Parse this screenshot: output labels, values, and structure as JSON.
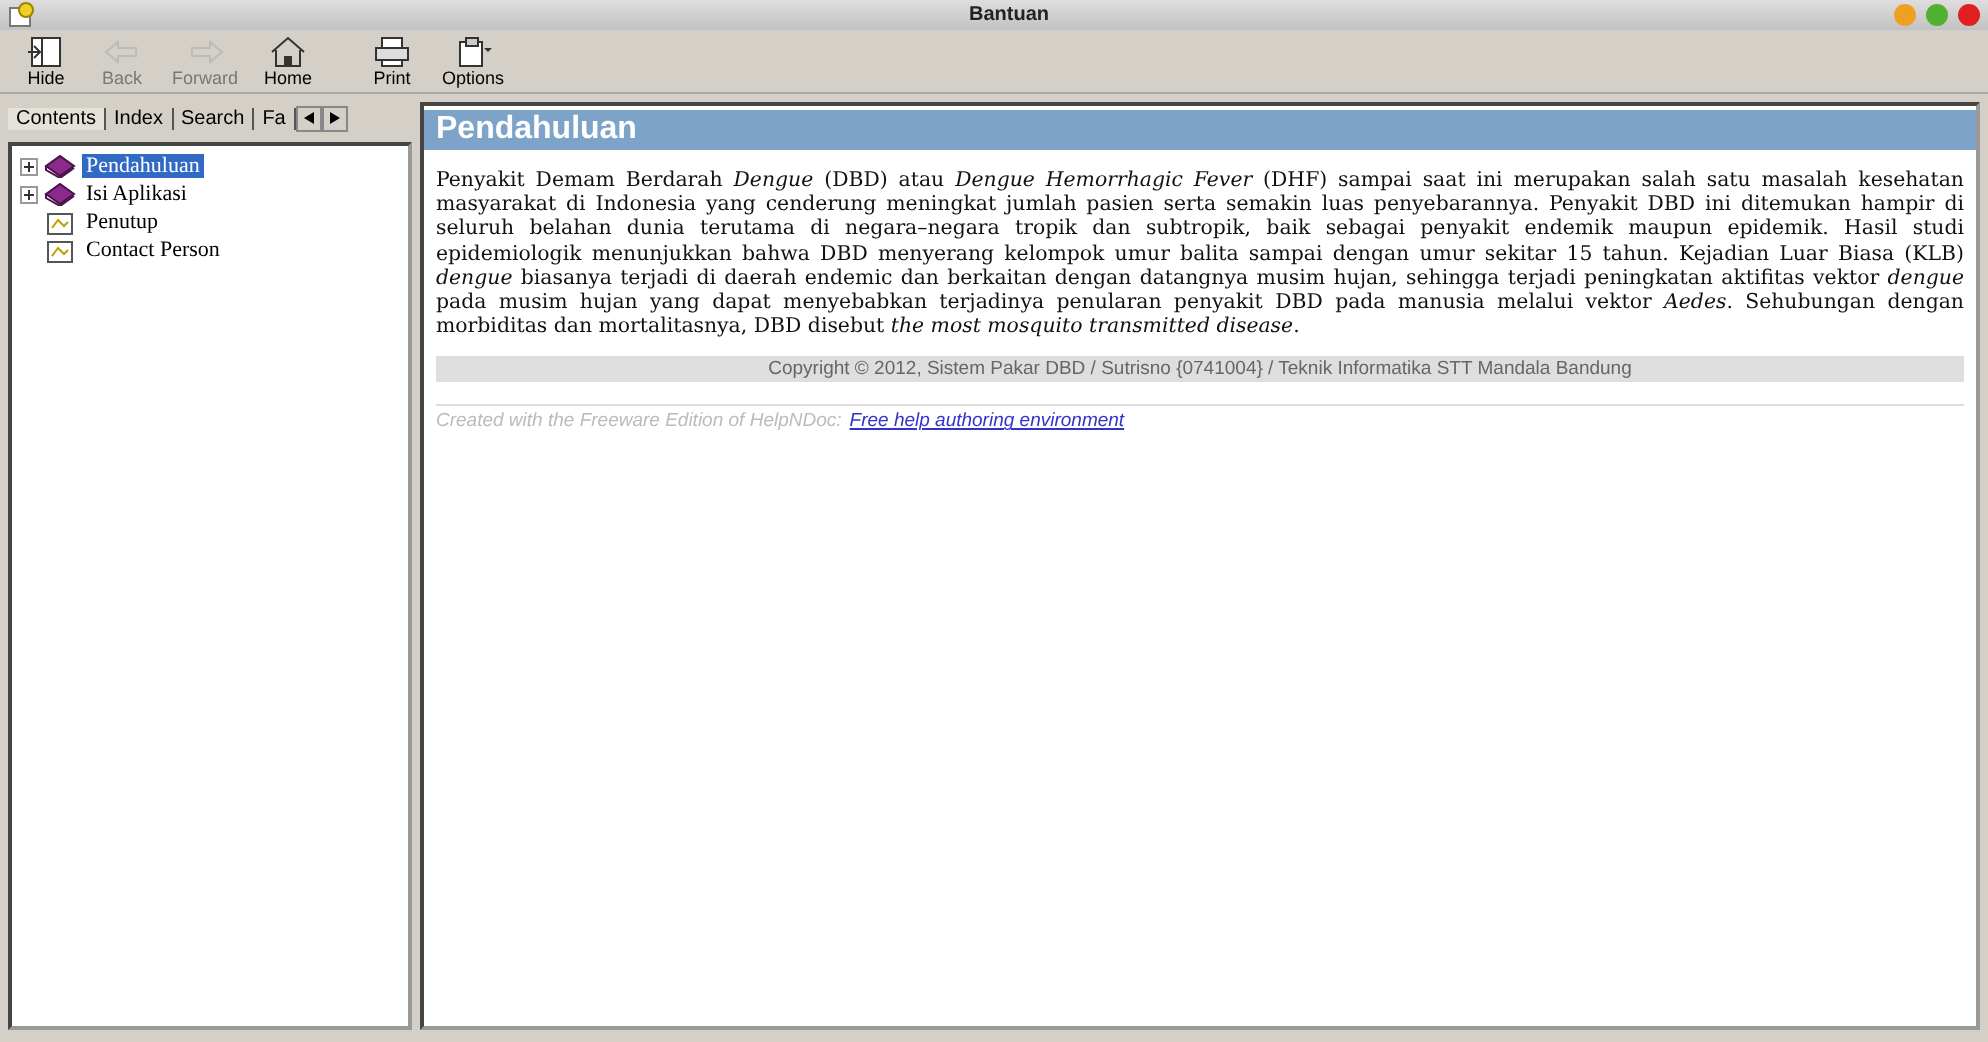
{
  "window": {
    "title": "Bantuan"
  },
  "toolbar": [
    {
      "label": "Hide",
      "kind": "hide",
      "disabled": false
    },
    {
      "label": "Back",
      "kind": "back",
      "disabled": true
    },
    {
      "label": "Forward",
      "kind": "forward",
      "disabled": true
    },
    {
      "label": "Home",
      "kind": "home",
      "disabled": false
    },
    {
      "label": "Print",
      "kind": "print",
      "disabled": false
    },
    {
      "label": "Options",
      "kind": "options",
      "disabled": false
    }
  ],
  "tabs": [
    {
      "label": "Contents",
      "selected": true
    },
    {
      "label": "Index",
      "selected": false
    },
    {
      "label": "Search",
      "selected": false
    },
    {
      "label": "Fa",
      "selected": false
    }
  ],
  "tree": [
    {
      "label": "Pendahuluan",
      "kind": "book",
      "expanded": false,
      "selected": true
    },
    {
      "label": "Isi Aplikasi",
      "kind": "book",
      "expanded": false,
      "selected": false
    },
    {
      "label": "Penutup",
      "kind": "page",
      "selected": false
    },
    {
      "label": "Contact Person",
      "kind": "page",
      "selected": false
    }
  ],
  "topic": {
    "title": "Pendahuluan",
    "paragraph": "Penyakit Demam Berdarah *Dengue* (DBD) atau *Dengue Hemorrhagic Fever* (DHF) sampai saat ini merupakan salah satu masalah kesehatan masyarakat di Indonesia yang cenderung meningkat jumlah pasien serta semakin luas penyebarannya. Penyakit DBD ini ditemukan hampir di seluruh belahan dunia terutama di negara–negara tropik dan subtropik, baik sebagai penyakit endemik maupun epidemik. Hasil studi epidemiologik menunjukkan bahwa DBD menyerang kelompok umur balita sampai dengan umur sekitar 15 tahun. Kejadian Luar Biasa (KLB) *dengue* biasanya terjadi di daerah endemic dan berkaitan dengan datangnya musim hujan, sehingga terjadi peningkatan aktifitas vektor *dengue* pada musim hujan yang dapat menyebabkan terjadinya penularan penyakit DBD pada manusia melalui vektor *Aedes*. Sehubungan dengan morbiditas dan mortalitasnya, DBD disebut *the most mosquito transmitted disease*.",
    "copyright": "Copyright © 2012, Sistem Pakar DBD / Sutrisno {0741004} / Teknik Informatika STT Mandala Bandung",
    "footer_text": "Created with the Freeware Edition of HelpNDoc:",
    "footer_link": "Free help authoring environment"
  }
}
